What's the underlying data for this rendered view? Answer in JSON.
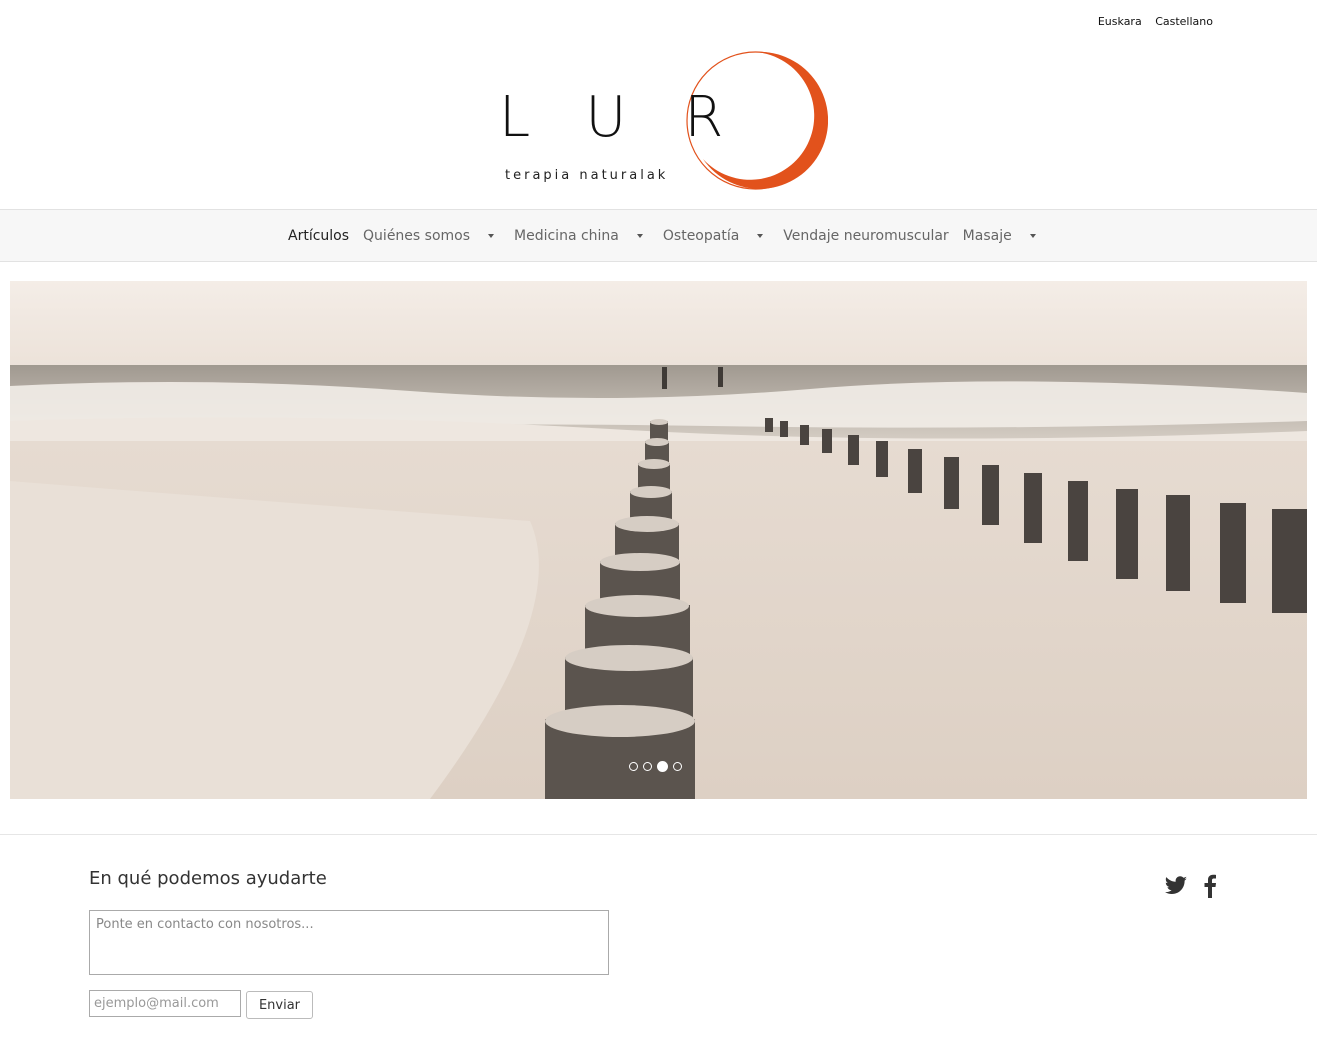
{
  "lang": {
    "euskara": "Euskara",
    "castellano": "Castellano"
  },
  "logo": {
    "letters": "LUR",
    "tagline": "terapia naturalak",
    "ring_color": "#e2521c"
  },
  "nav": {
    "items": [
      {
        "label": "Artículos",
        "dropdown": false,
        "active": true
      },
      {
        "label": "Quiénes somos",
        "dropdown": true
      },
      {
        "label": "Medicina china",
        "dropdown": true
      },
      {
        "label": "Osteopatía",
        "dropdown": true
      },
      {
        "label": "Vendaje neuromuscular",
        "dropdown": false
      },
      {
        "label": "Masaje",
        "dropdown": true
      }
    ]
  },
  "slider": {
    "slide_count": 4,
    "active_slide": 3
  },
  "contact": {
    "title": "En qué podemos ayudarte",
    "message_placeholder": "Ponte en contacto con nosotros...",
    "email_placeholder": "ejemplo@mail.com",
    "send_label": "Enviar"
  },
  "social": [
    "twitter-icon",
    "facebook-icon"
  ]
}
